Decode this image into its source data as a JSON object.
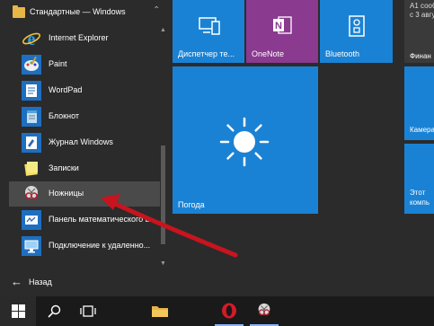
{
  "start_menu": {
    "group_header": "Стандартные — Windows",
    "apps": [
      {
        "label": "Internet Explorer",
        "icon": "internet-explorer-icon",
        "color": "#1e8fd6"
      },
      {
        "label": "Paint",
        "icon": "paint-icon",
        "color": "#2e6bb0"
      },
      {
        "label": "WordPad",
        "icon": "wordpad-icon",
        "color": "#2e6bb0"
      },
      {
        "label": "Блокнот",
        "icon": "notepad-icon",
        "color": "#2e6bb0"
      },
      {
        "label": "Журнал Windows",
        "icon": "windows-journal-icon",
        "color": "#2e6bb0"
      },
      {
        "label": "Записки",
        "icon": "sticky-notes-icon",
        "color": "#d9c23a"
      },
      {
        "label": "Ножницы",
        "icon": "snipping-tool-icon",
        "color": "#4a4a4a"
      },
      {
        "label": "Панель математического в...",
        "icon": "math-input-icon",
        "color": "#2e6bb0"
      },
      {
        "label": "Подключение к удаленно...",
        "icon": "remote-desktop-icon",
        "color": "#2e6bb0"
      }
    ],
    "back_label": "Назад"
  },
  "tiles": {
    "device_manager": "Диспетчер те...",
    "onenote": "OneNote",
    "bluetooth": "Bluetooth",
    "weather": "Погода",
    "right1_lines": [
      "А1 сооб",
      "с 3 авгу"
    ],
    "right1_label": "Финан",
    "right2_label": "Камера",
    "right3_lines": [
      "Этот",
      "компь"
    ]
  },
  "colors": {
    "tile_blue": "#1a82d4",
    "onenote_purple": "#8a3a8f",
    "annotation_red": "#c8141e"
  }
}
